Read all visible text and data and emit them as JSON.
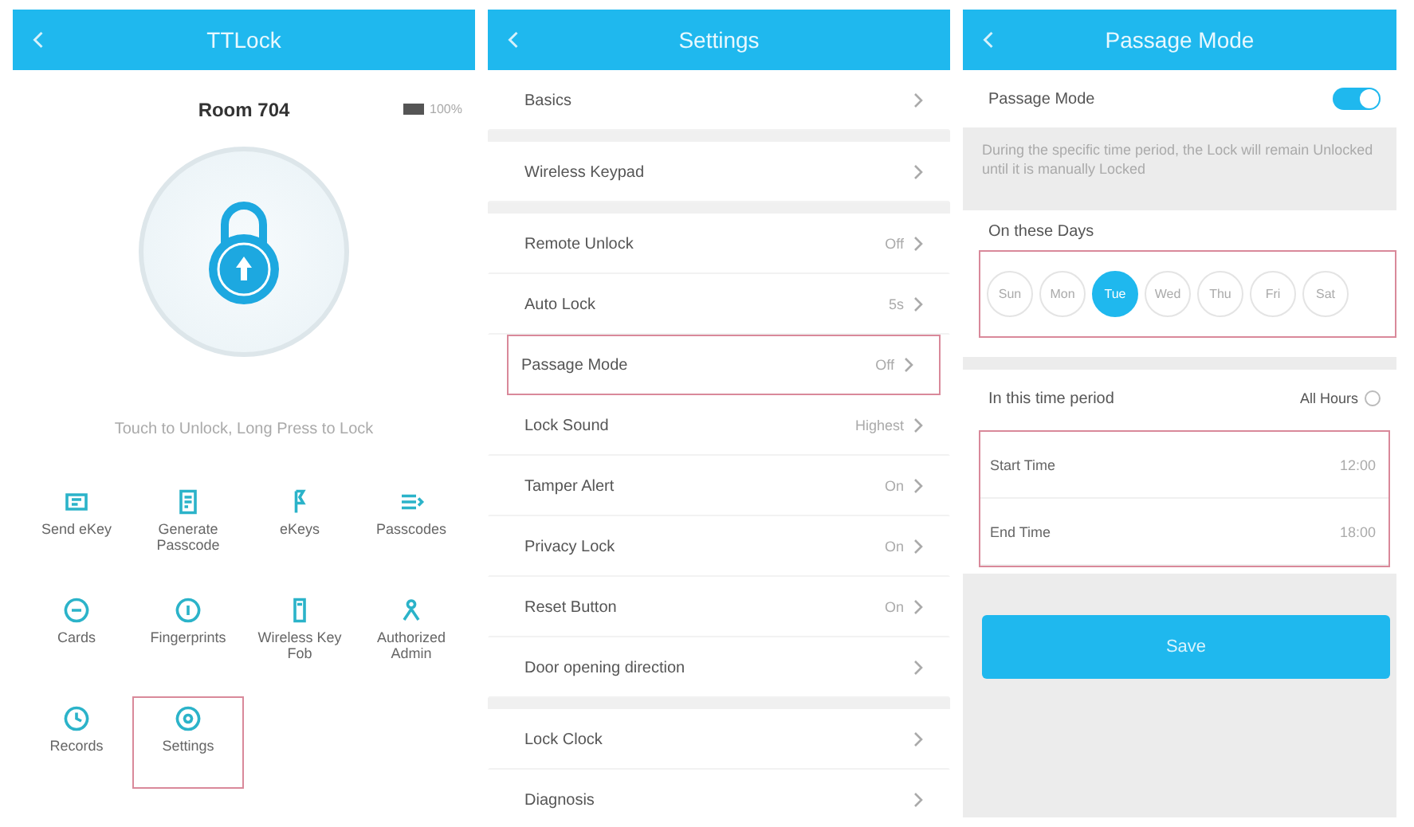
{
  "home": {
    "title": "TTLock",
    "lock_name": "Room 704",
    "battery": "100%",
    "hint": "Touch to Unlock, Long Press to Lock",
    "features": [
      {
        "label": "Send eKey",
        "kind": "ekey",
        "highlighted": false
      },
      {
        "label": "Generate Passcode",
        "kind": "passcode",
        "highlighted": false
      },
      {
        "label": "eKeys",
        "kind": "keys",
        "highlighted": false
      },
      {
        "label": "Passcodes",
        "kind": "list",
        "highlighted": false
      },
      {
        "label": "Cards",
        "kind": "card",
        "highlighted": false
      },
      {
        "label": "Fingerprints",
        "kind": "finger",
        "highlighted": false
      },
      {
        "label": "Wireless Key Fob",
        "kind": "fob",
        "highlighted": false
      },
      {
        "label": "Authorized Admin",
        "kind": "admin",
        "highlighted": false
      },
      {
        "label": "Records",
        "kind": "records",
        "highlighted": false
      },
      {
        "label": "Settings",
        "kind": "settings",
        "highlighted": true
      }
    ]
  },
  "settings": {
    "title": "Settings",
    "groups": [
      [
        {
          "label": "Basics",
          "highlighted": false
        }
      ],
      [
        {
          "label": "Wireless Keypad",
          "highlighted": false
        }
      ],
      [
        {
          "label": "Remote Unlock",
          "value": "Off",
          "highlighted": false
        },
        {
          "label": "Auto Lock",
          "value": "5s",
          "highlighted": false
        },
        {
          "label": "Passage Mode",
          "value": "Off",
          "highlighted": true
        },
        {
          "label": "Lock Sound",
          "value": "Highest",
          "highlighted": false
        },
        {
          "label": "Tamper Alert",
          "value": "On",
          "highlighted": false
        },
        {
          "label": "Privacy Lock",
          "value": "On",
          "highlighted": false
        },
        {
          "label": "Reset Button",
          "value": "On",
          "highlighted": false
        },
        {
          "label": "Door opening direction",
          "highlighted": false
        }
      ],
      [
        {
          "label": "Lock Clock",
          "highlighted": false
        },
        {
          "label": "Diagnosis",
          "highlighted": false
        }
      ]
    ]
  },
  "passage": {
    "title": "Passage Mode",
    "toggle": {
      "label": "Passage Mode",
      "on": true
    },
    "description": "During the specific time period, the Lock will remain Unlocked until it is manually Locked",
    "days_label": "On these Days",
    "days_highlighted": true,
    "days": [
      {
        "label": "Sun",
        "selected": false
      },
      {
        "label": "Mon",
        "selected": false
      },
      {
        "label": "Tue",
        "selected": true
      },
      {
        "label": "Wed",
        "selected": false
      },
      {
        "label": "Thu",
        "selected": false
      },
      {
        "label": "Fri",
        "selected": false
      },
      {
        "label": "Sat",
        "selected": false
      }
    ],
    "period_label": "In this time period",
    "all_hours": {
      "label": "All Hours",
      "checked": false
    },
    "times_highlighted": true,
    "times": [
      {
        "label": "Start Time",
        "value": "12:00"
      },
      {
        "label": "End Time",
        "value": "18:00"
      }
    ],
    "save": "Save"
  }
}
